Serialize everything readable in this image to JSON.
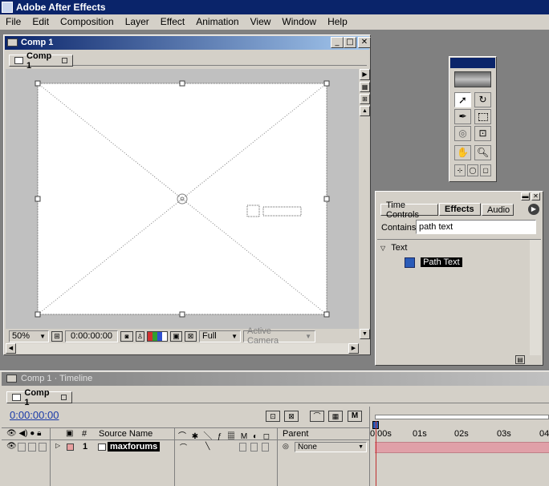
{
  "app": {
    "title": "Adobe After Effects"
  },
  "menu": [
    "File",
    "Edit",
    "Composition",
    "Layer",
    "Effect",
    "Animation",
    "View",
    "Window",
    "Help"
  ],
  "comp_window": {
    "title": "Comp 1",
    "tab": "Comp 1",
    "zoom": "50%",
    "timecode": "0:00:00:00",
    "resolution": "Full",
    "camera": "Active Camera"
  },
  "effects_palette": {
    "tabs": [
      "Time Controls",
      "Effects",
      "Audio"
    ],
    "contains_label": "Contains:",
    "contains_value": "path text",
    "category": "Text",
    "effect": "Path Text"
  },
  "timeline": {
    "title": "Comp 1 · Timeline",
    "tab": "Comp 1",
    "timecode": "0:00:00:00",
    "columns": {
      "number": "#",
      "source": "Source Name",
      "parent": "Parent"
    },
    "ruler": [
      "0:00s",
      "01s",
      "02s",
      "03s",
      "04"
    ],
    "layer": {
      "number": "1",
      "name": "maxforums",
      "parent": "None"
    }
  }
}
